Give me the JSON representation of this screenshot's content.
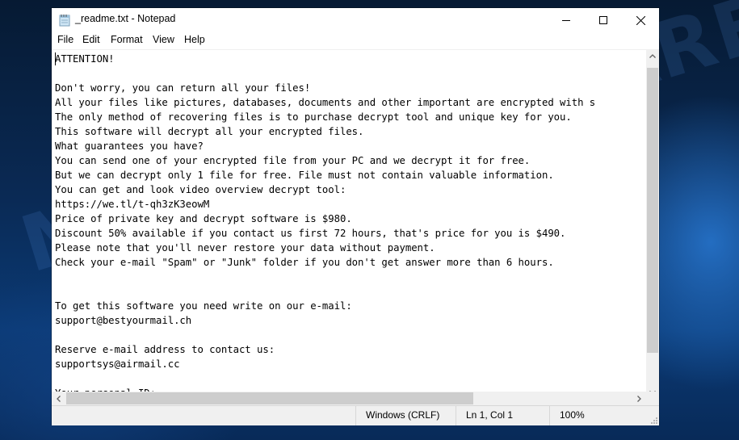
{
  "window": {
    "title": "_readme.txt - Notepad",
    "app_icon": "notepad-icon",
    "controls": {
      "minimize": "minimize-icon",
      "maximize": "maximize-icon",
      "close": "close-icon"
    }
  },
  "menubar": {
    "items": [
      {
        "label": "File"
      },
      {
        "label": "Edit"
      },
      {
        "label": "Format"
      },
      {
        "label": "View"
      },
      {
        "label": "Help"
      }
    ]
  },
  "editor": {
    "lines": [
      "ATTENTION!",
      "",
      "Don't worry, you can return all your files!",
      "All your files like pictures, databases, documents and other important are encrypted with s",
      "The only method of recovering files is to purchase decrypt tool and unique key for you.",
      "This software will decrypt all your encrypted files.",
      "What guarantees you have?",
      "You can send one of your encrypted file from your PC and we decrypt it for free.",
      "But we can decrypt only 1 file for free. File must not contain valuable information.",
      "You can get and look video overview decrypt tool:",
      "https://we.tl/t-qh3zK3eowM",
      "Price of private key and decrypt software is $980.",
      "Discount 50% available if you contact us first 72 hours, that's price for you is $490.",
      "Please note that you'll never restore your data without payment.",
      "Check your e-mail \"Spam\" or \"Junk\" folder if you don't get answer more than 6 hours.",
      "",
      "",
      "To get this software you need write on our e-mail:",
      "support@bestyourmail.ch",
      "",
      "Reserve e-mail address to contact us:",
      "supportsys@airmail.cc",
      "",
      "Your personal ID:"
    ]
  },
  "scrollbars": {
    "vertical_position": 0.0,
    "horizontal_position": 0.0,
    "horizontal_visible_fraction": 0.7
  },
  "statusbar": {
    "line_ending": "Windows (CRLF)",
    "cursor_position": "Ln 1, Col 1",
    "zoom": "100%"
  },
  "watermark": {
    "text": "MYANTISPYWARE.COM"
  }
}
